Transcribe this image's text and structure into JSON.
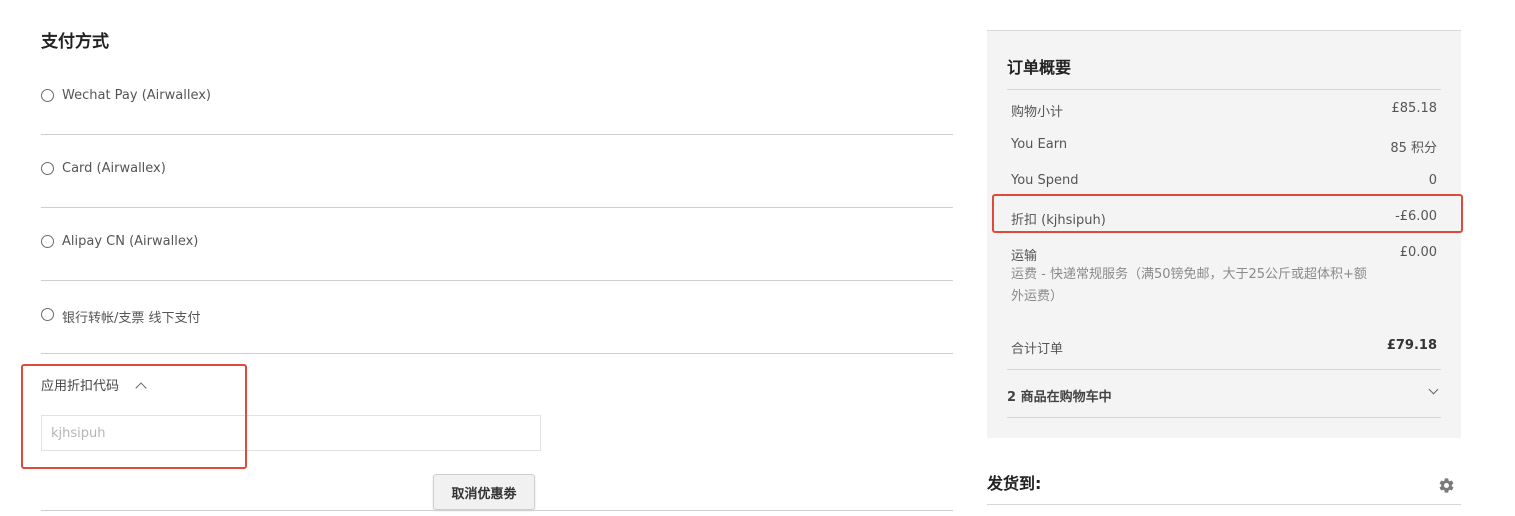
{
  "payment": {
    "title": "支付方式",
    "options": [
      {
        "label": "Wechat Pay (Airwallex)",
        "selected": false
      },
      {
        "label": "Card (Airwallex)",
        "selected": false
      },
      {
        "label": "Alipay CN (Airwallex)",
        "selected": false
      },
      {
        "label": "银行转帐/支票 线下支付",
        "selected": false
      }
    ]
  },
  "discount": {
    "header_label": "应用折扣代码",
    "input_value": "",
    "input_placeholder": "kjhsipuh",
    "cancel_button_label": "取消优惠劵"
  },
  "summary": {
    "title": "订单概要",
    "subtotal_label": "购物小计",
    "subtotal_value": "£85.18",
    "earn_label": "You Earn",
    "earn_value": "85 积分",
    "spend_label": "You Spend",
    "spend_value": "0",
    "discount_label": "折扣 (kjhsipuh)",
    "discount_value": "-£6.00",
    "shipping_label": "运输",
    "shipping_value": "£0.00",
    "shipping_desc": "运费 - 快递常规服务（满50镑免邮，大于25公斤或超体积+额外运费）",
    "total_label": "合计订单",
    "total_value": "£79.18",
    "cart_items_label": "2 商品在购物车中"
  },
  "ship_to": {
    "title": "发货到:"
  },
  "colors": {
    "highlight": "#e04a3a",
    "summary_bg": "#f4f4f4",
    "divider": "#cfcfcf"
  },
  "icons": {
    "collapse": "chevron-up-icon",
    "expand": "chevron-down-icon",
    "settings": "gear-icon"
  }
}
